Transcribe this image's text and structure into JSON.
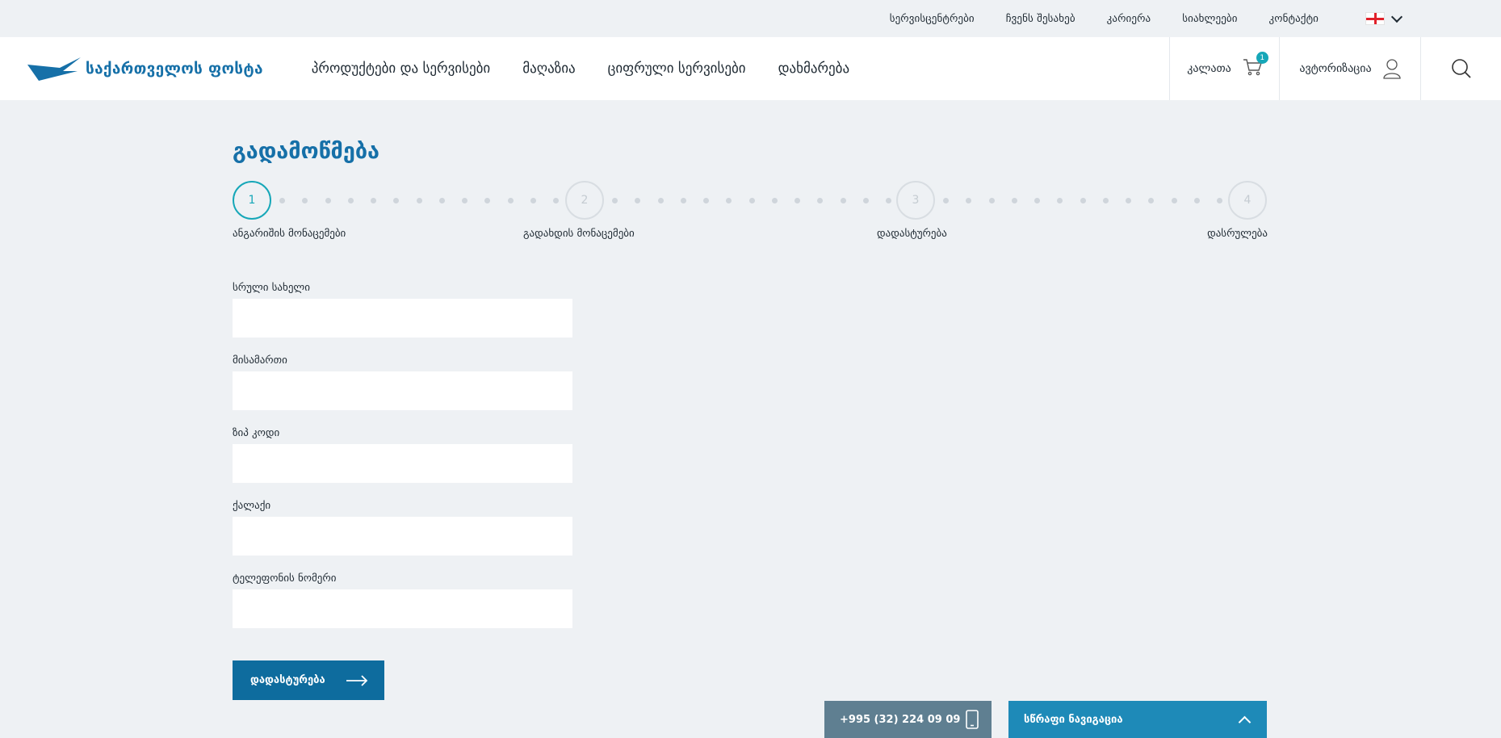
{
  "topbar": {
    "links": [
      "სერვისცენტრები",
      "ჩვენს შესახებ",
      "კარიერა",
      "სიახლეები",
      "კონტაქტი"
    ],
    "language": {
      "flag_icon": "georgia-flag-icon"
    }
  },
  "header": {
    "logo_text": "საქართველოს ფოსტა",
    "nav": [
      "პროდუქტები და სერვისები",
      "მაღაზია",
      "ციფრული სერვისები",
      "დახმარება"
    ],
    "cart": {
      "label": "კალათა",
      "count": "1"
    },
    "auth": {
      "label": "ავტორიზაცია"
    }
  },
  "checkout": {
    "title": "გადამოწმება",
    "steps": [
      {
        "number": "1",
        "label": "ანგარიშის მონაცემები",
        "active": true
      },
      {
        "number": "2",
        "label": "გადახდის მონაცემები",
        "active": false
      },
      {
        "number": "3",
        "label": "დადასტურება",
        "active": false
      },
      {
        "number": "4",
        "label": "დასრულება",
        "active": false
      }
    ],
    "fields": [
      {
        "label": "სრული სახელი",
        "value": "",
        "placeholder": ""
      },
      {
        "label": "მისამართი",
        "value": "",
        "placeholder": ""
      },
      {
        "label": "ზიპ კოდი",
        "value": "",
        "placeholder": ""
      },
      {
        "label": "ქალაქი",
        "value": "",
        "placeholder": ""
      },
      {
        "label": "ტელეფონის ნომერი",
        "value": "",
        "placeholder": ""
      }
    ],
    "submit_label": "დადასტურება"
  },
  "footer_bar": {
    "phone": "+995 (32) 224 09 09",
    "quick_nav_label": "სწრაფი ნავიგაცია"
  },
  "colors": {
    "brand": "#1670a8",
    "accent": "#16a7b8",
    "button": "#0e6c9e",
    "background": "#eef1f4"
  }
}
